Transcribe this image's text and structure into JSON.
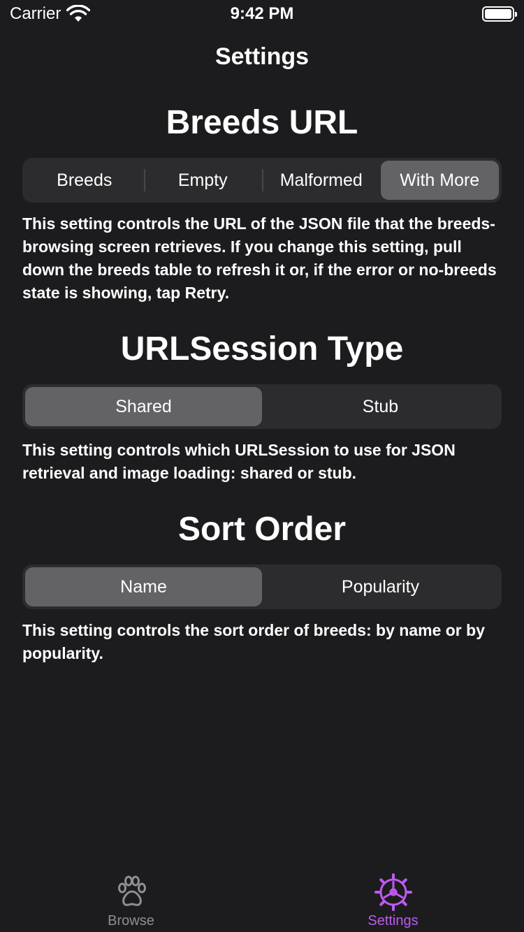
{
  "status_bar": {
    "carrier": "Carrier",
    "time": "9:42 PM"
  },
  "nav": {
    "title": "Settings"
  },
  "breeds_url": {
    "title": "Breeds URL",
    "segments": [
      "Breeds",
      "Empty",
      "Malformed",
      "With More"
    ],
    "selected": "With More",
    "description": "This setting controls the URL of the JSON file that the breeds-browsing screen retrieves. If you change this setting, pull down the breeds table to refresh it or, if the error or no-breeds state is showing, tap Retry."
  },
  "urlsession": {
    "title": "URLSession Type",
    "segments": [
      "Shared",
      "Stub"
    ],
    "selected": "Shared",
    "description": "This setting controls which URLSession to use for JSON retrieval and image loading: shared or stub."
  },
  "sort_order": {
    "title": "Sort Order",
    "segments": [
      "Name",
      "Popularity"
    ],
    "selected": "Name",
    "description": "This setting controls the sort order of breeds: by name or by popularity."
  },
  "tab_bar": {
    "items": [
      {
        "label": "Browse",
        "icon": "paw-icon",
        "active": false
      },
      {
        "label": "Settings",
        "icon": "gear-icon",
        "active": true
      }
    ]
  },
  "colors": {
    "background": "#1c1c1e",
    "segment_bg": "#2c2c2e",
    "segment_selected": "#636366",
    "accent": "#bf5af2",
    "inactive": "#8e8e93"
  }
}
